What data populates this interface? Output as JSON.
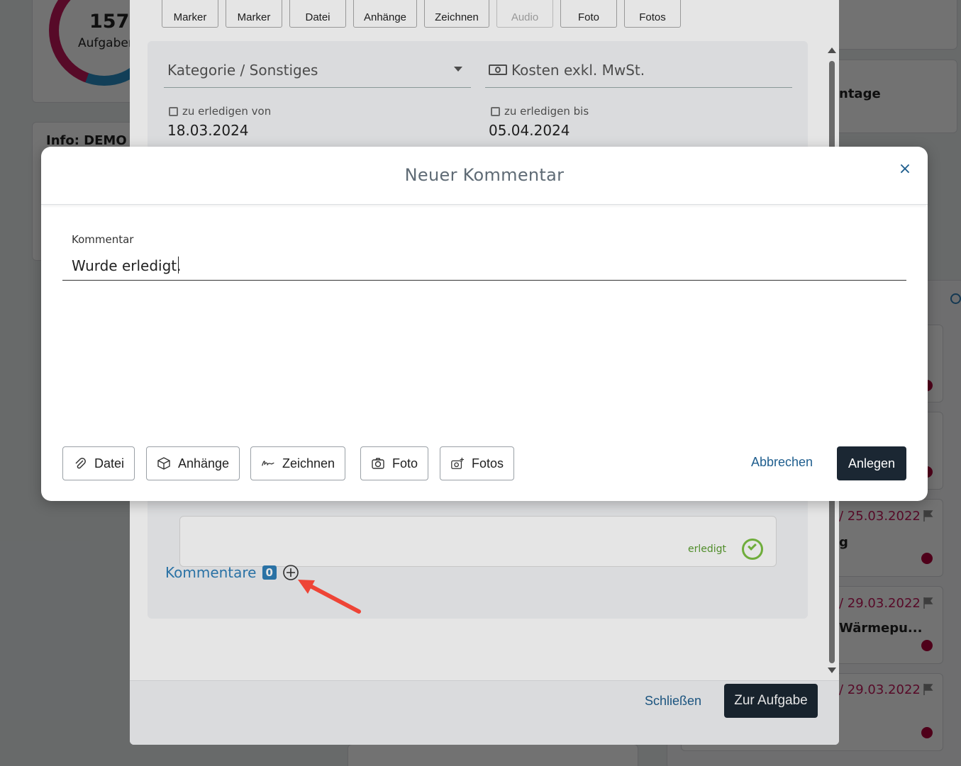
{
  "background": {
    "stats": {
      "count": "157",
      "label": "Aufgaben"
    },
    "info_title": "Info: DEMO I",
    "right_labels": [
      "ntage",
      "g",
      "Wärmepu..."
    ],
    "dates": [
      "/ 25.03.2022",
      "/ 29.03.2022",
      "/ 29.03.2022"
    ]
  },
  "task_modal": {
    "toolbar": [
      {
        "label": "Marker",
        "enabled": true
      },
      {
        "label": "Marker",
        "enabled": true
      },
      {
        "label": "Datei",
        "enabled": true
      },
      {
        "label": "Anhänge",
        "enabled": true
      },
      {
        "label": "Zeichnen",
        "enabled": true
      },
      {
        "label": "Audio",
        "enabled": false
      },
      {
        "label": "Foto",
        "enabled": true
      },
      {
        "label": "Fotos",
        "enabled": true
      }
    ],
    "category_placeholder": "Kategorie / Sonstiges",
    "cost_placeholder": "Kosten exkl. MwSt.",
    "due_from_label": "zu erledigen von",
    "due_from_value": "18.03.2024",
    "due_to_label": "zu erledigen bis",
    "due_to_value": "05.04.2024",
    "status_text": "erledigt",
    "comments_label": "Kommentare",
    "comments_count": "0",
    "close_label": "Schließen",
    "goto_label": "Zur Aufgabe"
  },
  "comment_modal": {
    "title": "Neuer Kommentar",
    "close_symbol": "×",
    "field_label": "Kommentar",
    "field_value": "Wurde erledigt.",
    "buttons": {
      "file": "Datei",
      "attachments": "Anhänge",
      "draw": "Zeichnen",
      "photo": "Foto",
      "photos": "Fotos"
    },
    "cancel_label": "Abbrechen",
    "create_label": "Anlegen"
  },
  "colors": {
    "accent": "#1f5e8e",
    "dark_button": "#1b2733",
    "annotation_arrow": "#ee4436",
    "status_red": "#c2185b"
  }
}
